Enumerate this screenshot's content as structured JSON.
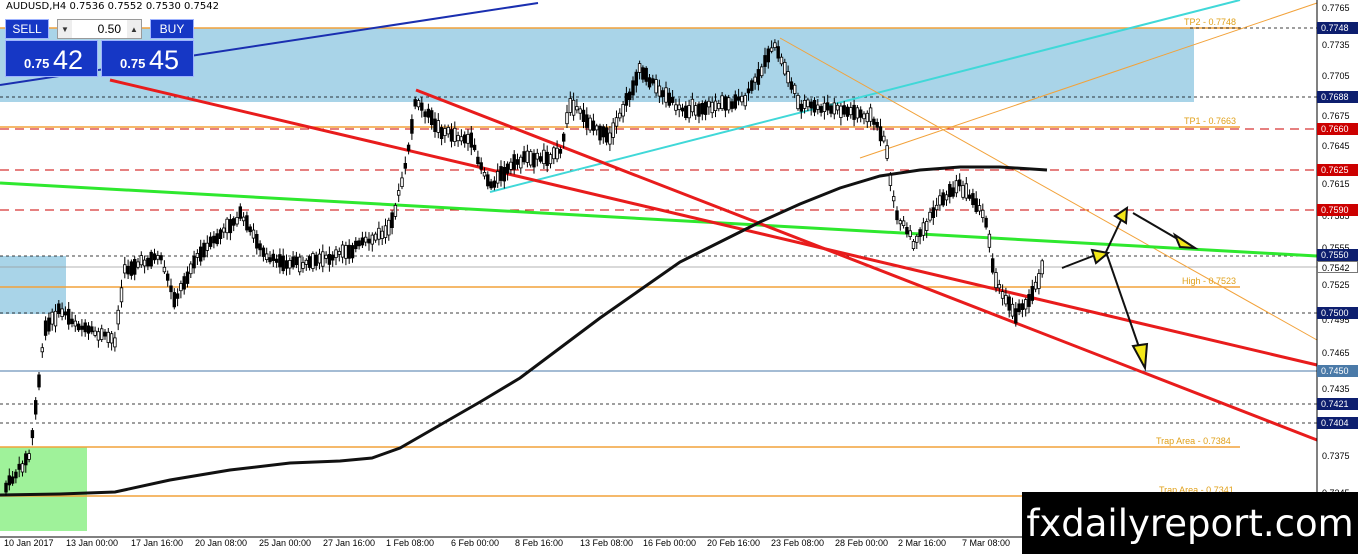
{
  "header": {
    "symbol": "AUDUSD,H4",
    "ohlc": "0.7536 0.7552 0.7530 0.7542"
  },
  "trade_panel": {
    "sell_label": "SELL",
    "buy_label": "BUY",
    "lot_value": "0.50",
    "sell_price_small": "0.75",
    "sell_price_big": "42",
    "buy_price_small": "0.75",
    "buy_price_big": "45",
    "down_arrow": "▼",
    "up_arrow": "▲"
  },
  "price_axis": [
    "0.7765",
    "0.7735",
    "0.7705",
    "0.7675",
    "0.7645",
    "0.7615",
    "0.7585",
    "0.7555",
    "0.7525",
    "0.7495",
    "0.7465",
    "0.7435",
    "0.7375",
    "0.7345"
  ],
  "price_tags": [
    {
      "text": "0.7748",
      "style": "navy"
    },
    {
      "text": "0.7688",
      "style": "navy"
    },
    {
      "text": "0.7660",
      "style": "red"
    },
    {
      "text": "0.7625",
      "style": "red"
    },
    {
      "text": "0.7590",
      "style": "red"
    },
    {
      "text": "0.7550",
      "style": "navy"
    },
    {
      "text": "0.7542",
      "style": "plain"
    },
    {
      "text": "0.7500",
      "style": "navy"
    },
    {
      "text": "0.7450",
      "style": "steel"
    },
    {
      "text": "0.7421",
      "style": "navy"
    },
    {
      "text": "0.7404",
      "style": "navy"
    }
  ],
  "level_labels": [
    {
      "text": "TP2 - 0.7748"
    },
    {
      "text": "TP1 - 0.7663"
    },
    {
      "text": "High - 0.7523"
    },
    {
      "text": "Trap Area  - 0.7384"
    },
    {
      "text": "Trap Area - 0.7341"
    }
  ],
  "time_axis": [
    "10 Jan 2017",
    "13 Jan 00:00",
    "17 Jan 16:00",
    "20 Jan 08:00",
    "25 Jan 00:00",
    "27 Jan 16:00",
    "1 Feb 08:00",
    "6 Feb 00:00",
    "8 Feb 16:00",
    "13 Feb 08:00",
    "16 Feb 00:00",
    "20 Feb 16:00",
    "23 Feb 08:00",
    "28 Feb 00:00",
    "2 Mar 16:00",
    "7 Mar 08:00"
  ],
  "watermark": "fxdailyreport.com",
  "colors": {
    "panel": "#1637c5",
    "zone": "#a9d4e8",
    "red_tag": "#cc0000",
    "navy_tag": "#0d1e6e",
    "orange": "#f2a23a"
  }
}
